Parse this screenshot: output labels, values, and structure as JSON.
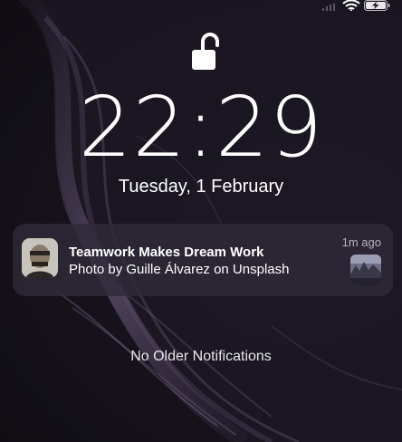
{
  "status_bar": {
    "signal_icon": "cellular-signal-icon",
    "wifi_icon": "wifi-icon",
    "battery_icon": "battery-charging-icon"
  },
  "lock": {
    "icon": "lock-open-icon"
  },
  "clock": {
    "time": "22:29",
    "date": "Tuesday, 1 February"
  },
  "notification": {
    "title": "Teamwork Makes Dream Work",
    "body": "Photo by Guille Álvarez on Unsplash",
    "time": "1m ago",
    "avatar_icon": "avatar",
    "thumbnail": "photo-thumbnail"
  },
  "footer": {
    "no_older_label": "No Older Notifications"
  },
  "colors": {
    "background": "#141218",
    "notification_bg": "#302a38",
    "text": "#ffffff",
    "secondary_text": "#b7b2bd"
  }
}
